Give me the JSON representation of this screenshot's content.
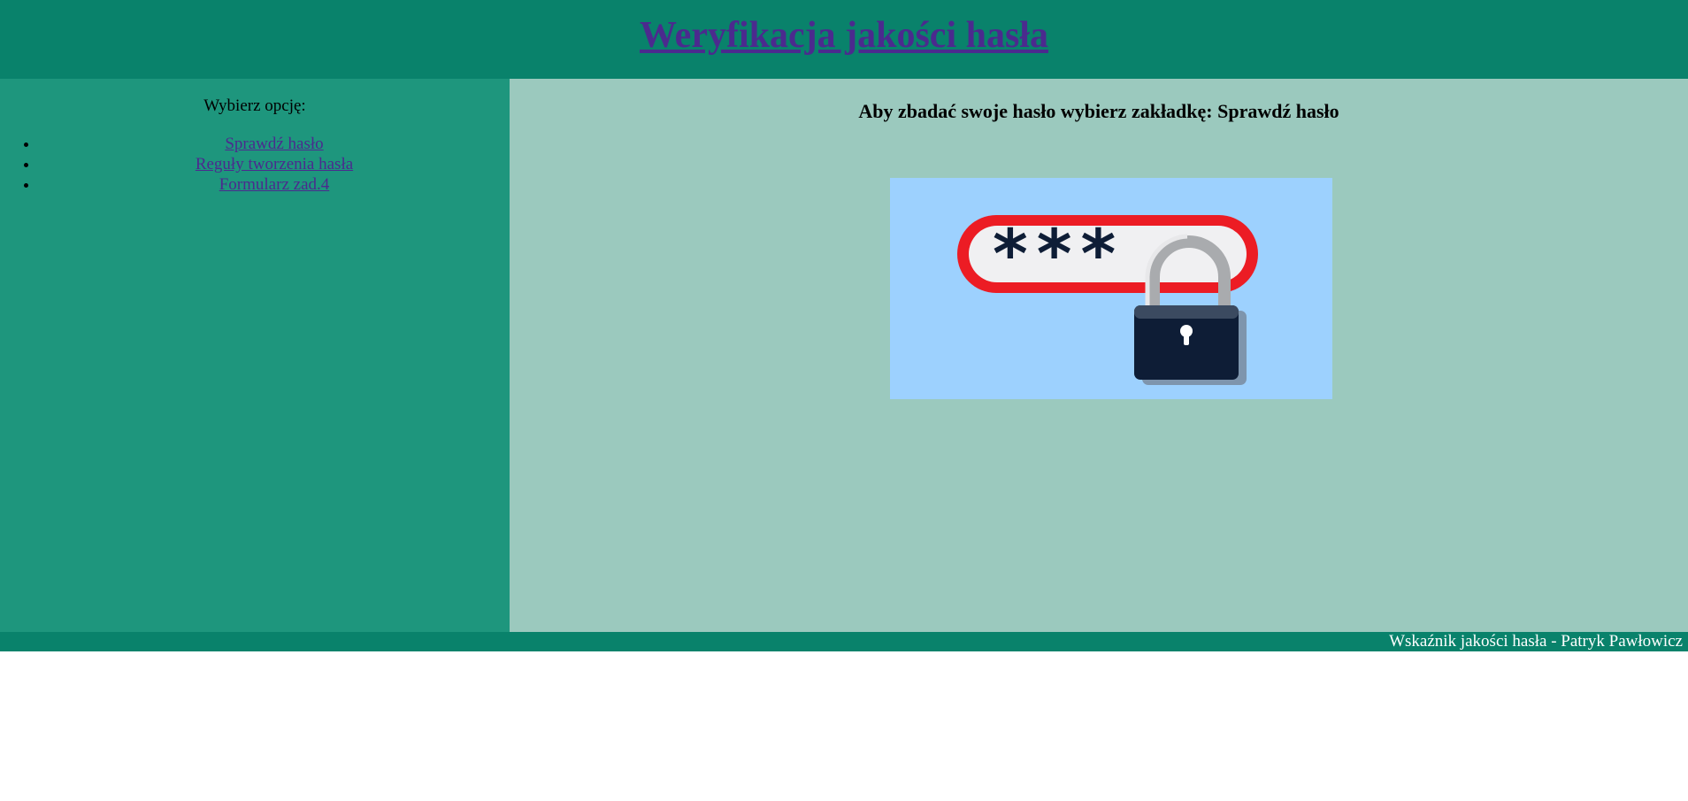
{
  "header": {
    "title": "Weryfikacja jakości hasła"
  },
  "sidebar": {
    "prompt": "Wybierz opcję:",
    "items": [
      {
        "label": "Sprawdź hasło"
      },
      {
        "label": "Reguły tworzenia hasła"
      },
      {
        "label": "Formularz zad.4"
      }
    ]
  },
  "main": {
    "heading": "Aby zbadać swoje hasło wybierz zakładkę: Sprawdź hasło",
    "image": {
      "icon": "password-lock-illustration",
      "masked_text": "***"
    }
  },
  "footer": {
    "text": "Wskaźnik jakości hasła - Patryk Pawłowicz"
  },
  "colors": {
    "header_bg": "#09826b",
    "sidebar_bg": "#1e967d",
    "main_bg": "#9bc9be",
    "link": "#4b2a8e",
    "image_bg": "#9dd1fe",
    "field_border": "#ec1c24",
    "lock_body": "#0e1d36"
  }
}
